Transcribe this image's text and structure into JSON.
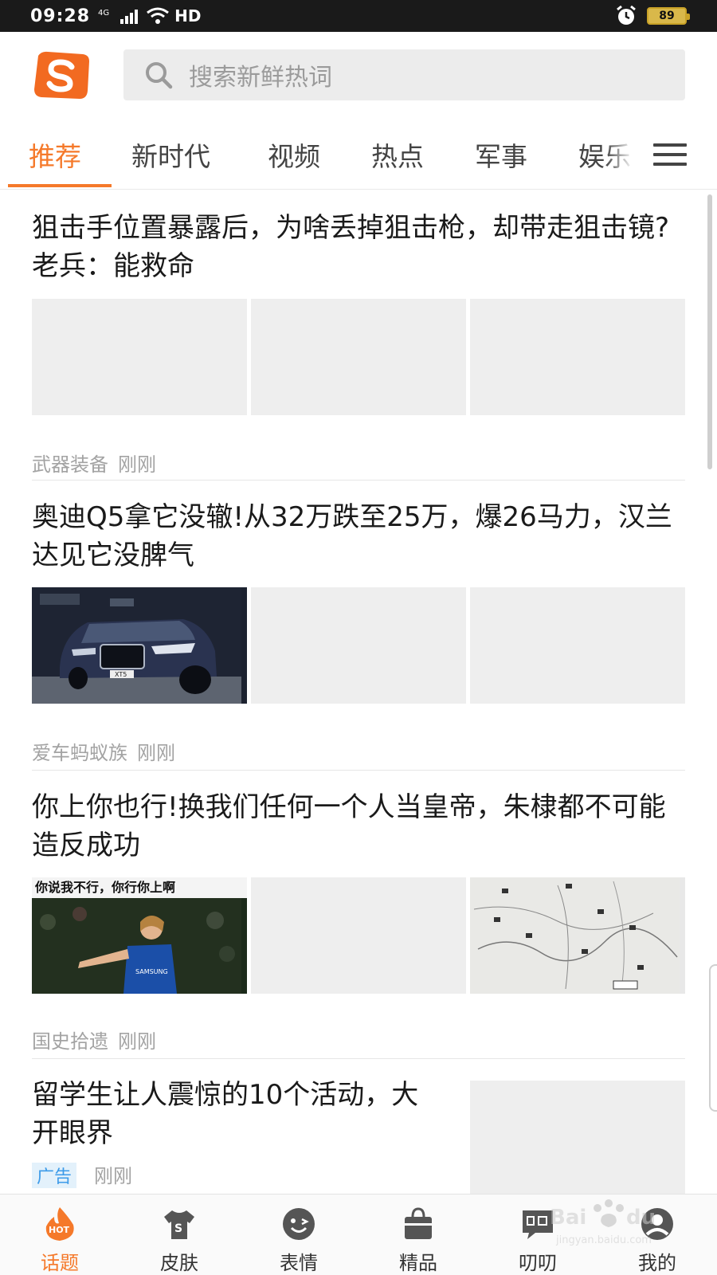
{
  "status_bar": {
    "time": "09:28",
    "network": "4G",
    "hd": "HD",
    "battery": "89"
  },
  "search": {
    "placeholder": "搜索新鲜热词"
  },
  "tabs": [
    {
      "label": "推荐",
      "active": true
    },
    {
      "label": "新时代"
    },
    {
      "label": "视频"
    },
    {
      "label": "热点"
    },
    {
      "label": "军事"
    },
    {
      "label": "娱乐"
    }
  ],
  "articles": [
    {
      "title": "狙击手位置暴露后，为啥丢掉狙击枪，却带走狙击镜?老兵：能救命",
      "source": "武器装备",
      "time": "刚刚"
    },
    {
      "title": "奥迪Q5拿它没辙!从32万跌至25万，爆26马力，汉兰达见它没脾气",
      "source": "爱车蚂蚁族",
      "time": "刚刚",
      "image_caption": "XT5"
    },
    {
      "title": "你上你也行!换我们任何一个人当皇帝，朱棣都不可能造反成功",
      "source": "国史拾遗",
      "time": "刚刚",
      "image_caption": "你说我不行，你行你上啊"
    },
    {
      "title": "留学生让人震惊的10个活动，大开眼界",
      "badge": "广告",
      "time": "刚刚"
    }
  ],
  "bottom_nav": [
    {
      "label": "话题",
      "icon": "hot-icon",
      "active": true
    },
    {
      "label": "皮肤",
      "icon": "skin-shirt-icon"
    },
    {
      "label": "表情",
      "icon": "emoji-icon"
    },
    {
      "label": "精品",
      "icon": "bag-icon"
    },
    {
      "label": "叨叨",
      "icon": "chat-bubble-icon"
    },
    {
      "label": "我的",
      "icon": "profile-icon"
    }
  ],
  "colors": {
    "accent": "#f5792a",
    "ad_badge": "#3d9be9"
  }
}
